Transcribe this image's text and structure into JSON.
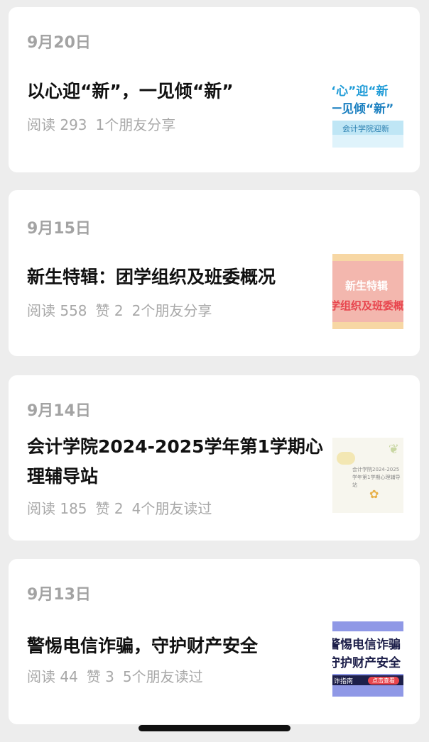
{
  "articles": [
    {
      "date": "9月20日",
      "title": "以心迎“新”，一见倾“新”",
      "reads": "阅读 293",
      "likes": "",
      "social": "1个朋友分享",
      "thumb": {
        "line1": "“心”迎“新",
        "line2": "一见倾“新”",
        "band": "会计学院迎新"
      }
    },
    {
      "date": "9月15日",
      "title": "新生特辑：团学组织及班委概况",
      "reads": "阅读 558",
      "likes": "赞 2",
      "social": "2个朋友分享",
      "thumb": {
        "line1": "新生特辑",
        "line2": "学组织及班委概"
      }
    },
    {
      "date": "9月14日",
      "title": "会计学院2024-2025学年第1学期心理辅导站",
      "reads": "阅读 185",
      "likes": "赞 2",
      "social": "4个朋友读过",
      "thumb": {
        "text": "会计学院2024-2025学年第1学期心理辅导站"
      }
    },
    {
      "date": "9月13日",
      "title": "警惕电信诈骗，守护财产安全",
      "reads": "阅读 44",
      "likes": "赞 3",
      "social": "5个朋友读过",
      "thumb": {
        "line1": "警惕电信诈骗",
        "line2": "守护财产安全",
        "bar": "诈指南",
        "button": "点击查看"
      }
    }
  ],
  "colors": {
    "background": "#ededed",
    "card": "#ffffff",
    "meta": "#a8a8a8",
    "title": "#111111"
  }
}
